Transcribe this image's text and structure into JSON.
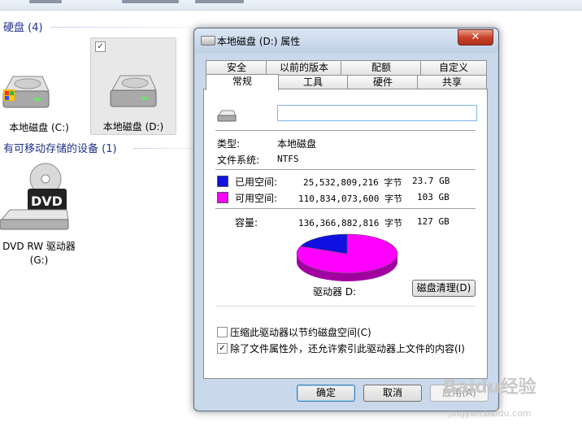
{
  "explorer": {
    "hard_disks_header": "硬盘 (4)",
    "removable_header": "有可移动存储的设备 (1)",
    "drives": [
      {
        "label": "本地磁盘 (C:)"
      },
      {
        "label": "本地磁盘 (D:)"
      }
    ],
    "dvd": {
      "label_line1": "DVD RW 驱动器",
      "label_line2": "(G:)",
      "badge": "DVD"
    }
  },
  "dialog": {
    "title": "本地磁盘 (D:) 属性",
    "close_glyph": "✕",
    "tabs_back": [
      "安全",
      "以前的版本",
      "配额",
      "自定义"
    ],
    "tabs_front": [
      "常规",
      "工具",
      "硬件",
      "共享"
    ],
    "active_tab": "常规",
    "name_value": "",
    "type_label": "类型:",
    "type_value": "本地磁盘",
    "fs_label": "文件系统:",
    "fs_value": "NTFS",
    "used_label": "已用空间:",
    "used_bytes": "25,532,809,216 字节",
    "used_gb": "23.7 GB",
    "free_label": "可用空间:",
    "free_bytes": "110,834,073,600 字节",
    "free_gb": "103 GB",
    "capacity_label": "容量:",
    "capacity_bytes": "136,366,882,816 字节",
    "capacity_gb": "127 GB",
    "drive_label": "驱动器 D:",
    "cleanup_button": "磁盘清理(D)",
    "compress_option": "压缩此驱动器以节约磁盘空间(C)",
    "index_option": "除了文件属性外，还允许索引此驱动器上文件的内容(I)",
    "index_checked": true,
    "compress_checked": false,
    "ok_button": "确定",
    "cancel_button": "取消",
    "apply_button": "应用(A)",
    "colors": {
      "used": "#1010e0",
      "free": "#ff00ff"
    },
    "used_fraction": 0.187
  },
  "watermark": {
    "text": "Baidu经验",
    "url": "jingyan.baidu.com"
  }
}
